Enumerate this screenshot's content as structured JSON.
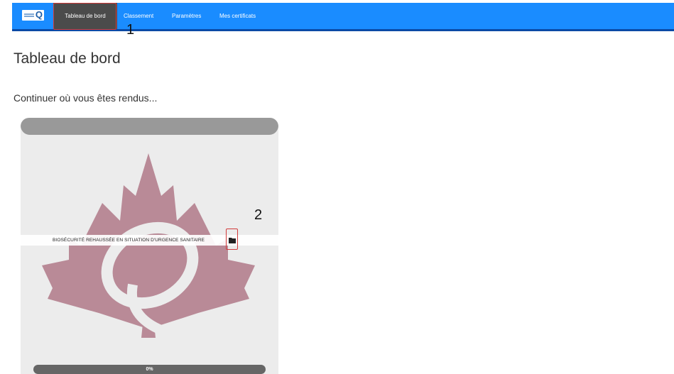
{
  "nav": {
    "items": [
      {
        "label": "Tableau de bord",
        "active": true
      },
      {
        "label": "Classement",
        "active": false
      },
      {
        "label": "Paramètres",
        "active": false
      },
      {
        "label": "Mes certificats",
        "active": false
      }
    ]
  },
  "annotations": {
    "marker_1": "1",
    "marker_2": "2"
  },
  "page": {
    "title": "Tableau de bord",
    "subtitle": "Continuer où vous êtes rendus..."
  },
  "course": {
    "title": "BIOSÉCURITÉ REHAUSSÉE EN SITUATION D'URGENCE SANITAIRE",
    "progress_label": "0%",
    "progress": 0
  },
  "colors": {
    "navbar": "#1a8cff",
    "nav_active": "#4b4b4b",
    "leaf": "#b98a97",
    "annotation": "#d13a3a"
  },
  "icons": {
    "logo": "organization-logo",
    "course_action": "folder-icon"
  }
}
